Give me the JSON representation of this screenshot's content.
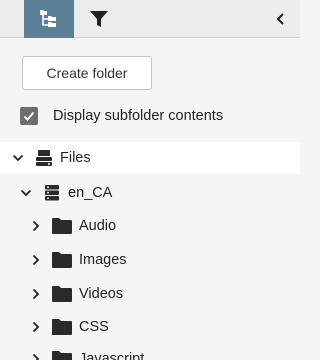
{
  "toolbar": {
    "tabs": [
      {
        "icon": "folder-tree-icon",
        "active": true
      },
      {
        "icon": "filter-icon",
        "active": false
      }
    ],
    "collapse_icon": "chevron-left-icon"
  },
  "actions": {
    "create_folder_label": "Create folder"
  },
  "options": {
    "display_subfolder_label": "Display subfolder contents",
    "display_subfolder_checked": true
  },
  "tree": {
    "root": {
      "label": "Files",
      "icon": "drive-icon",
      "expanded": true,
      "selected": true
    },
    "locale": {
      "label": "en_CA",
      "icon": "server-icon",
      "expanded": true
    },
    "folders": [
      {
        "label": "Audio",
        "icon": "folder-icon",
        "expanded": false
      },
      {
        "label": "Images",
        "icon": "folder-icon",
        "expanded": false
      },
      {
        "label": "Videos",
        "icon": "folder-icon",
        "expanded": false
      },
      {
        "label": "CSS",
        "icon": "folder-icon",
        "expanded": false
      },
      {
        "label": "Javascript",
        "icon": "folder-icon",
        "expanded": false
      }
    ]
  }
}
